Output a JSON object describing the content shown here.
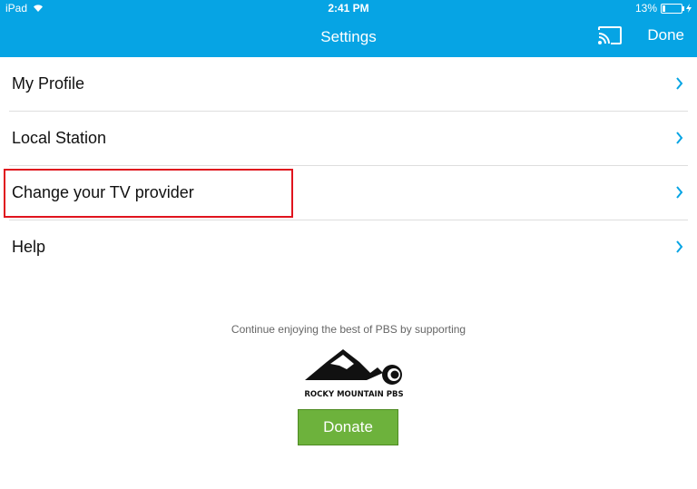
{
  "status_bar": {
    "device": "iPad",
    "time": "2:41 PM",
    "battery": "13%"
  },
  "nav": {
    "title": "Settings",
    "done_label": "Done"
  },
  "settings_items": [
    {
      "label": "My Profile"
    },
    {
      "label": "Local Station"
    },
    {
      "label": "Change your TV provider"
    },
    {
      "label": "Help"
    }
  ],
  "support": {
    "text": "Continue enjoying the best of PBS by supporting",
    "station_name": "ROCKY MOUNTAIN PBS",
    "donate_label": "Donate"
  },
  "colors": {
    "nav_bar": "#06a4e4",
    "chevron": "#06a4e4",
    "donate": "#6db23c",
    "highlight": "#e0141e"
  }
}
